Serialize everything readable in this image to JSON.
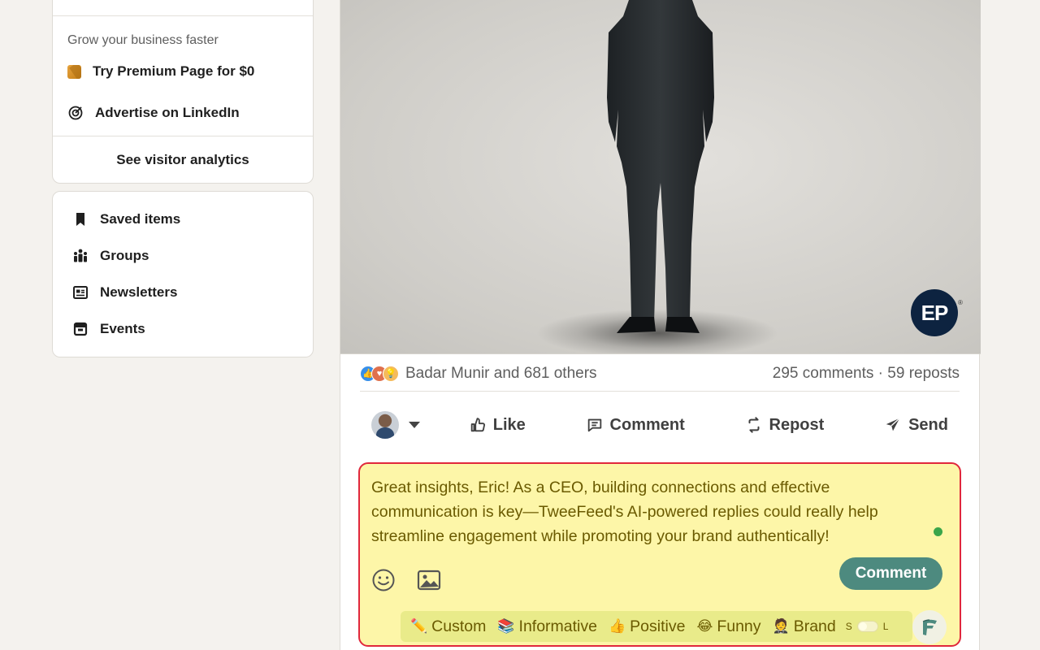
{
  "premium_card": {
    "grow_text": "Grow your business faster",
    "premium_link": "Try Premium Page for $0",
    "advertise_link": "Advertise on LinkedIn",
    "analytics_link": "See visitor analytics"
  },
  "nav_card": {
    "items": [
      {
        "label": "Saved items",
        "icon": "bookmark-icon"
      },
      {
        "label": "Groups",
        "icon": "groups-icon"
      },
      {
        "label": "Newsletters",
        "icon": "newsletter-icon"
      },
      {
        "label": "Events",
        "icon": "calendar-icon"
      }
    ]
  },
  "post": {
    "logo_text": "EP",
    "logo_reg": "®",
    "reactions_text": "Badar Munir and 681 others",
    "stats_text": "295 comments · 59 reposts",
    "actions": {
      "like": "Like",
      "comment": "Comment",
      "repost": "Repost",
      "send": "Send"
    }
  },
  "comment_box": {
    "text": "Great insights, Eric! As a CEO, building connections and effective communication is key—TweeFeed's AI-powered replies could really help streamline engagement while promoting your brand authentically!",
    "submit_label": "Comment",
    "tones": [
      {
        "emoji": "✏️",
        "label": "Custom"
      },
      {
        "emoji": "📚",
        "label": "Informative"
      },
      {
        "emoji": "👍",
        "label": "Positive"
      },
      {
        "emoji": "😂",
        "label": "Funny"
      },
      {
        "emoji": "🤵",
        "label": "Brand"
      }
    ],
    "size_small": "S",
    "size_large": "L"
  },
  "colors": {
    "comment_bg": "#fdf6a8",
    "comment_border": "#e0283c",
    "submit_bg": "#4d8a7f",
    "status_green": "#3aa54a",
    "page_bg": "#f4f2ee"
  }
}
